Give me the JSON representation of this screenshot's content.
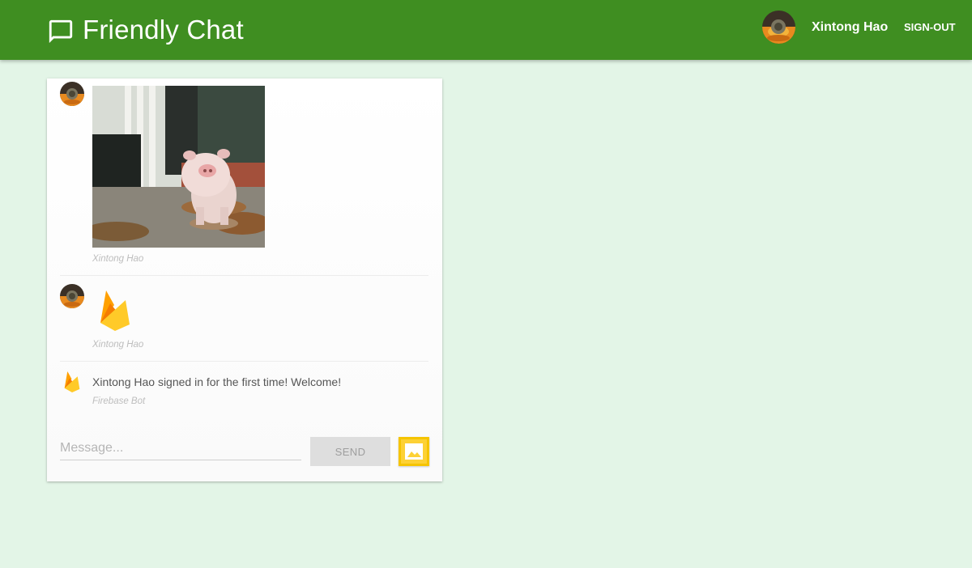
{
  "header": {
    "app_title": "Friendly Chat",
    "logo_icon": "chat-bubble-icon",
    "user_name": "Xintong Hao",
    "sign_out_label": "SIGN-OUT",
    "background_color": "#3f8e21"
  },
  "messages": [
    {
      "type": "image",
      "author": "Xintong Hao",
      "avatar_icon": "user-avatar",
      "image_icon": "pig-photo"
    },
    {
      "type": "image",
      "author": "Xintong Hao",
      "avatar_icon": "user-avatar",
      "image_icon": "firebase-flame-icon"
    },
    {
      "type": "text",
      "author": "Firebase Bot",
      "avatar_icon": "firebase-flame-icon",
      "text": "Xintong Hao signed in for the first time! Welcome!"
    }
  ],
  "composer": {
    "placeholder": "Message...",
    "value": "",
    "send_label": "SEND",
    "image_button_icon": "image-icon"
  },
  "colors": {
    "page_background": "#e3f5e7",
    "accent_yellow": "#fdd135"
  }
}
